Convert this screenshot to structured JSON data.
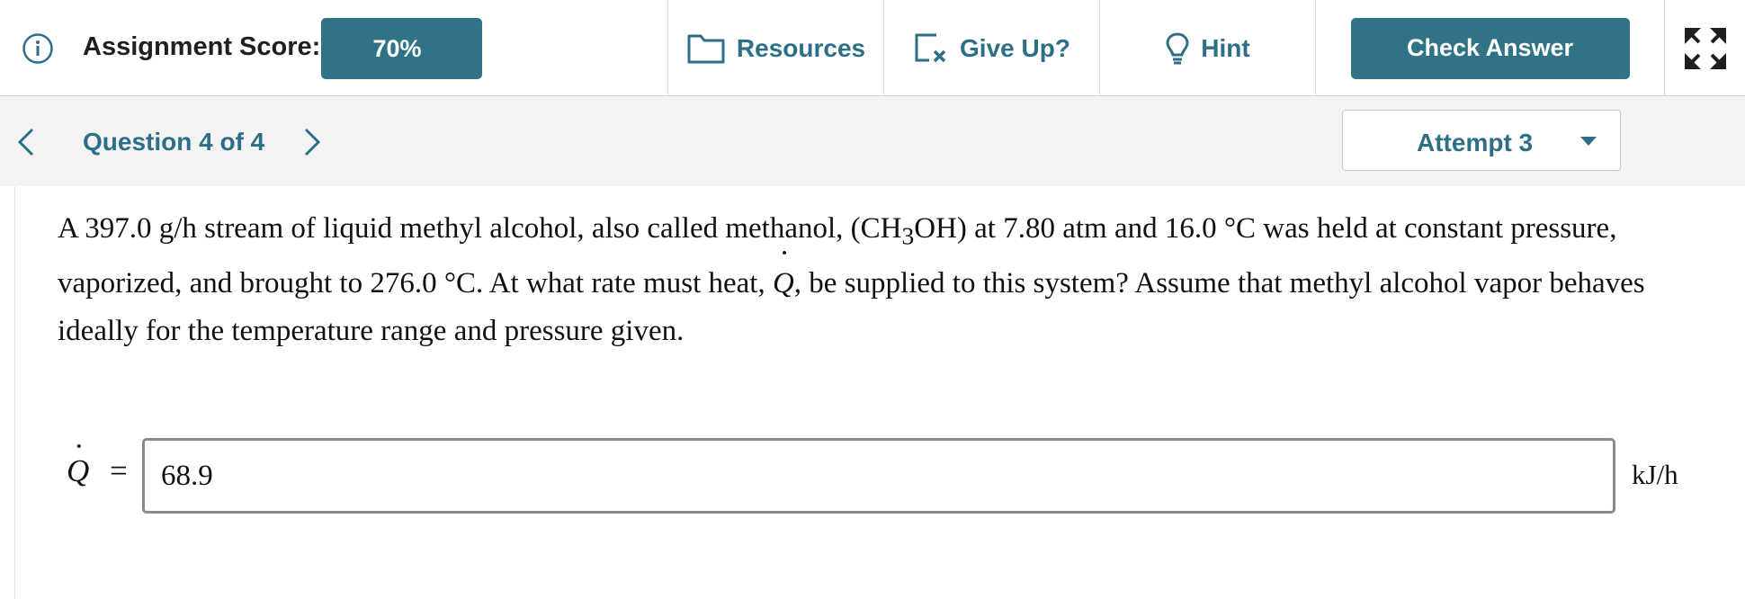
{
  "toolbar": {
    "score_label": "Assignment Score:",
    "score_value": "70%",
    "resources_label": "Resources",
    "giveup_label": "Give Up?",
    "hint_label": "Hint",
    "check_label": "Check Answer"
  },
  "nav": {
    "question_label": "Question 4 of 4",
    "attempt_label": "Attempt 3"
  },
  "question": {
    "part1": "A 397.0 g/h stream of liquid methyl alcohol, also called methanol, (CH",
    "sub": "3",
    "part2": "OH) at 7.80 atm and 16.0 °C was held at constant pressure, vaporized, and brought to 276.0 °C. At what rate must heat, ",
    "symbol": "Q",
    "part3": ", be supplied to this system? Assume that methyl alcohol vapor behaves ideally for the temperature range and pressure given."
  },
  "answer": {
    "symbol": "Q",
    "equals": "=",
    "value": "68.9",
    "unit": "kJ/h"
  },
  "colors": {
    "accent": "#307387",
    "link": "#2d6f86",
    "nav_bg": "#f3f3f3"
  },
  "icons": [
    "info-icon",
    "folder-icon",
    "give-up-icon",
    "lightbulb-icon",
    "expand-icon",
    "chevron-left-icon",
    "chevron-right-icon",
    "caret-down-icon"
  ]
}
